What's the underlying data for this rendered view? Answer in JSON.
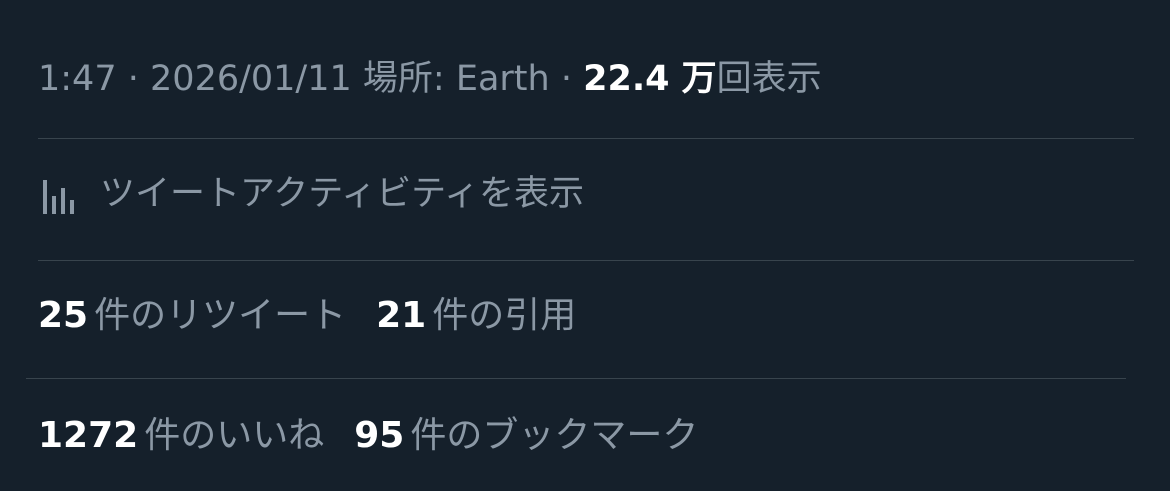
{
  "meta": {
    "time": "1:47",
    "date": "2026/01/11",
    "location_label": "場所:",
    "location": "Earth",
    "separator": "·",
    "views_count": "22.4 万",
    "views_label": "回表示"
  },
  "activity": {
    "icon": "analytics-bar-icon",
    "label": "ツイートアクティビティを表示"
  },
  "stats": {
    "retweets_count": "25",
    "retweets_label": "件のリツイート",
    "quotes_count": "21",
    "quotes_label": "件の引用",
    "likes_count": "1272",
    "likes_label": "件のいいね",
    "bookmarks_count": "95",
    "bookmarks_label": "件のブックマーク"
  },
  "colors": {
    "background": "#15202b",
    "secondary_text": "#8b98a5",
    "primary_text": "#ffffff",
    "divider": "#38444d"
  }
}
